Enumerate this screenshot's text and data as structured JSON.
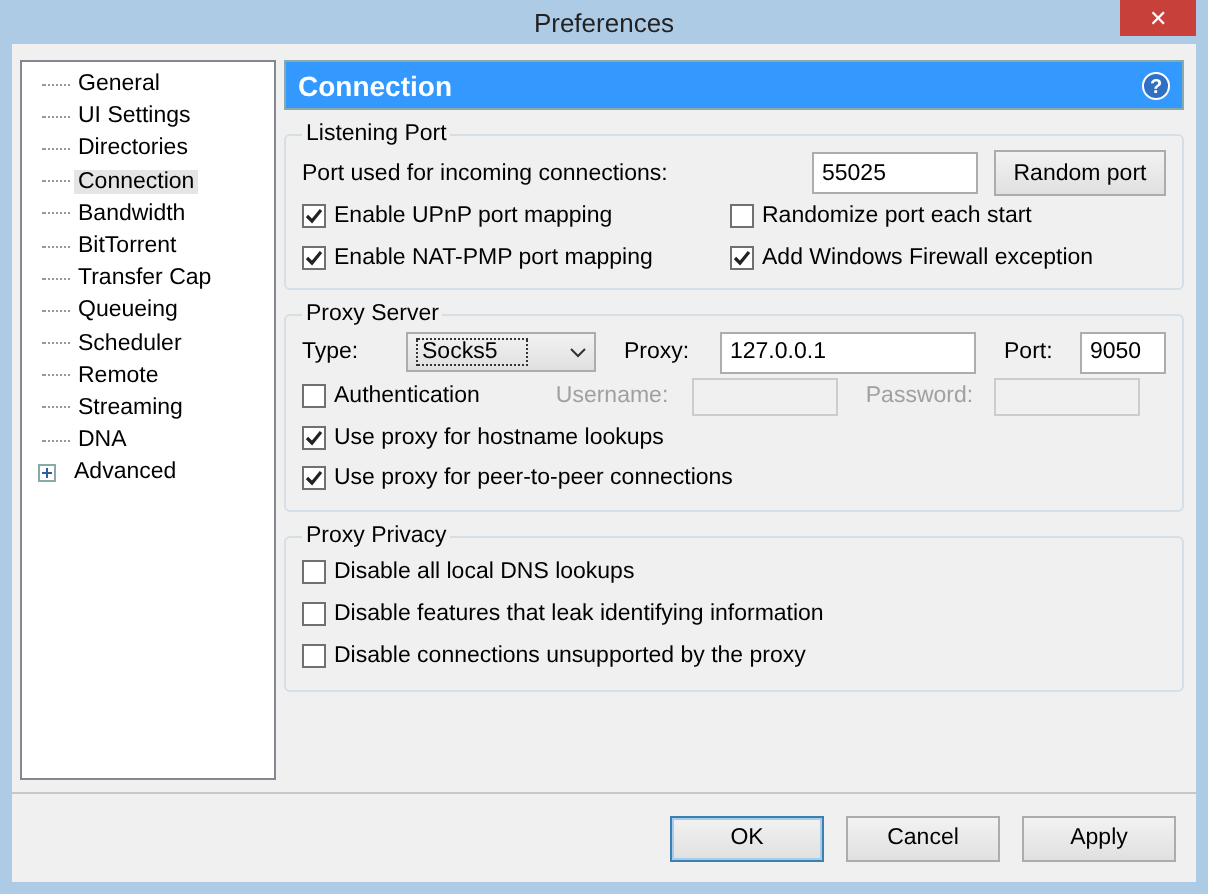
{
  "window": {
    "title": "Preferences",
    "close": "✕"
  },
  "sidebar": {
    "items": [
      {
        "label": "General",
        "selected": false,
        "kind": "leaf"
      },
      {
        "label": "UI Settings",
        "selected": false,
        "kind": "leaf"
      },
      {
        "label": "Directories",
        "selected": false,
        "kind": "leaf"
      },
      {
        "label": "Connection",
        "selected": true,
        "kind": "leaf"
      },
      {
        "label": "Bandwidth",
        "selected": false,
        "kind": "leaf"
      },
      {
        "label": "BitTorrent",
        "selected": false,
        "kind": "leaf"
      },
      {
        "label": "Transfer Cap",
        "selected": false,
        "kind": "leaf"
      },
      {
        "label": "Queueing",
        "selected": false,
        "kind": "leaf"
      },
      {
        "label": "Scheduler",
        "selected": false,
        "kind": "leaf"
      },
      {
        "label": "Remote",
        "selected": false,
        "kind": "leaf"
      },
      {
        "label": "Streaming",
        "selected": false,
        "kind": "leaf"
      },
      {
        "label": "DNA",
        "selected": false,
        "kind": "leaf"
      },
      {
        "label": "Advanced",
        "selected": false,
        "kind": "branch",
        "expanded": false
      }
    ]
  },
  "header": {
    "title": "Connection",
    "help": "?"
  },
  "listening_port": {
    "title": "Listening Port",
    "port_label": "Port used for incoming connections:",
    "port_value": "55025",
    "random_button": "Random port",
    "checkboxes": [
      {
        "label": "Enable UPnP port mapping",
        "checked": true
      },
      {
        "label": "Randomize port each start",
        "checked": false
      },
      {
        "label": "Enable NAT-PMP port mapping",
        "checked": true
      },
      {
        "label": "Add Windows Firewall exception",
        "checked": true
      }
    ]
  },
  "proxy_server": {
    "title": "Proxy Server",
    "type_label": "Type:",
    "type_value": "Socks5",
    "proxy_label": "Proxy:",
    "proxy_value": "127.0.0.1",
    "port_label": "Port:",
    "port_value": "9050",
    "authentication": {
      "label": "Authentication",
      "checked": false
    },
    "username_label": "Username:",
    "password_label": "Password:",
    "credentials_disabled": true,
    "checkboxes": [
      {
        "label": "Use proxy for hostname lookups",
        "checked": true
      },
      {
        "label": "Use proxy for peer-to-peer connections",
        "checked": true
      }
    ]
  },
  "proxy_privacy": {
    "title": "Proxy Privacy",
    "checkboxes": [
      {
        "label": "Disable all local DNS lookups",
        "checked": false
      },
      {
        "label": "Disable features that leak identifying information",
        "checked": false
      },
      {
        "label": "Disable connections unsupported by the proxy",
        "checked": false
      }
    ]
  },
  "buttons": [
    {
      "label": "OK",
      "default": true
    },
    {
      "label": "Cancel",
      "default": false
    },
    {
      "label": "Apply",
      "default": false
    }
  ]
}
